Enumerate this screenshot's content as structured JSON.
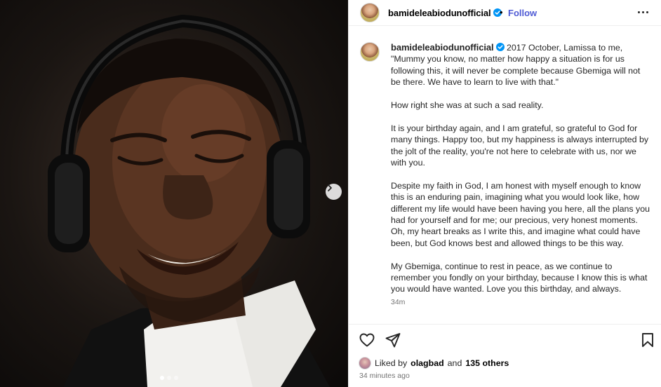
{
  "post": {
    "username": "bamideleabiodunofficial",
    "separator": "•",
    "follow_label": "Follow",
    "verified_icon": "verified-badge-icon",
    "more_icon": "more-options-icon"
  },
  "media": {
    "description_icon": "next-slide-icon",
    "slide_count": 3,
    "active_slide": 1
  },
  "caption": {
    "username": "bamideleabiodunofficial",
    "paragraphs": [
      "2017 October, Lamissa to me, \"Mummy you know, no matter how happy a situation is for us following this, it will never be complete because Gbemiga will not be there. We have to learn to live with that.\"",
      "How right she was at such a sad reality.",
      "It is your birthday again, and I am grateful, so grateful to God for many things. Happy too, but my happiness is always interrupted by the jolt of the reality, you're not here to celebrate with us, nor we with you.",
      "Despite my faith in God, I am honest with myself enough to know this is an enduring pain, imagining what you would look like, how different my life would have been having you here, all the plans you had for yourself and for me; our precious, very honest moments. Oh, my heart breaks as I write this, and imagine what could have been, but God knows best and allowed things to be this way.",
      "My Gbemiga, continue to rest in peace, as we continue to remember you fondly on your birthday, because I know this is what you would have wanted. Love you this birthday, and always."
    ],
    "time": "34m"
  },
  "actions": {
    "like_icon": "heart-icon",
    "share_icon": "send-icon",
    "save_icon": "bookmark-icon"
  },
  "likes": {
    "prefix": "Liked by",
    "user": "olagbad",
    "middle": "and",
    "others": "135 others"
  },
  "time_ago": "34 minutes ago",
  "colors": {
    "accent": "#4f5bd5",
    "verified": "#0095f6",
    "muted": "#737373"
  }
}
